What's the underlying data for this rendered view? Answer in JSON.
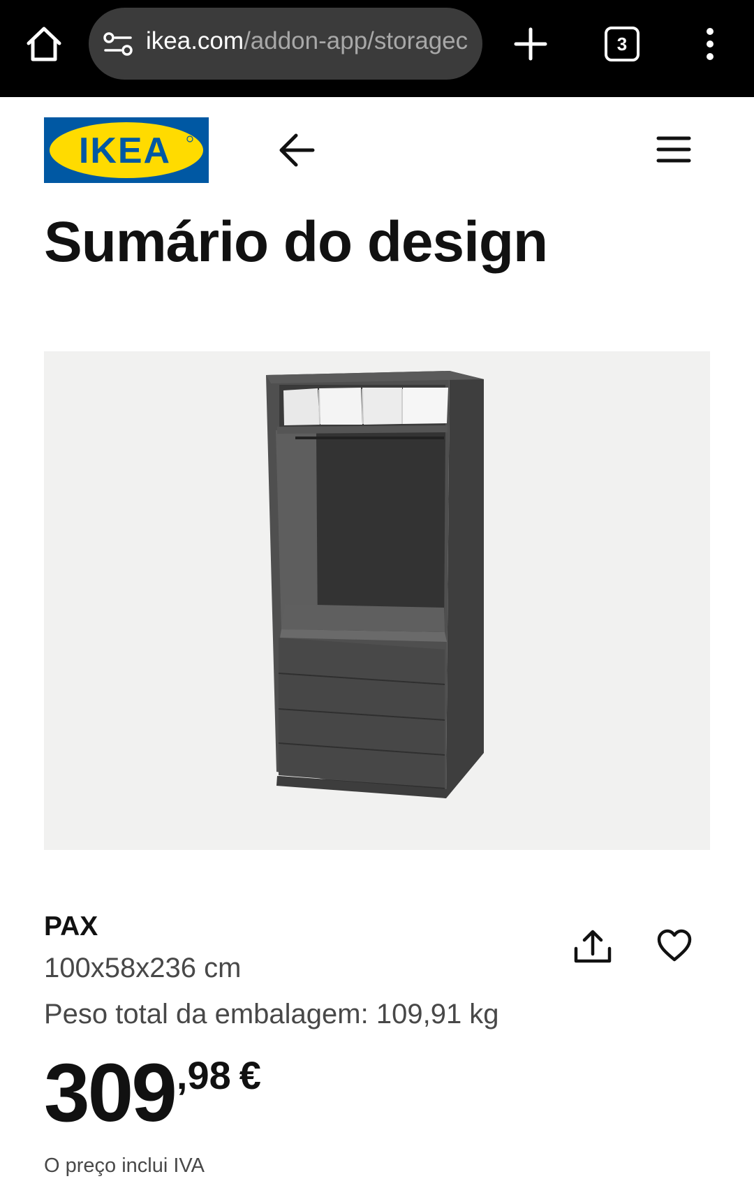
{
  "browser": {
    "url_host": "ikea.com",
    "url_path": "/addon-app/storagec",
    "tab_count": "3",
    "icons": {
      "home": "home-icon",
      "site_settings": "site-settings-icon",
      "new_tab": "plus-icon",
      "tabs": "tab-switcher-icon",
      "more": "more-vertical-icon"
    }
  },
  "header": {
    "logo_text": "IKEA",
    "icons": {
      "back": "arrow-left-icon",
      "menu": "hamburger-menu-icon"
    }
  },
  "page": {
    "title": "Sumário do design"
  },
  "product": {
    "name": "PAX",
    "dimensions": "100x58x236 cm",
    "weight": "Peso total da embalagem: 109,91 kg",
    "price_integer": "309",
    "price_decimal": ",98",
    "currency": "€",
    "tax_note": "O preço inclui IVA",
    "icons": {
      "share": "share-icon",
      "favourite": "heart-icon"
    }
  },
  "colors": {
    "ikea_blue": "#0058a3",
    "ikea_yellow": "#ffdb00",
    "browser_bar": "#000000",
    "image_background": "#f1f1f0",
    "wardrobe_dark_grey": "#4a4a4a"
  }
}
